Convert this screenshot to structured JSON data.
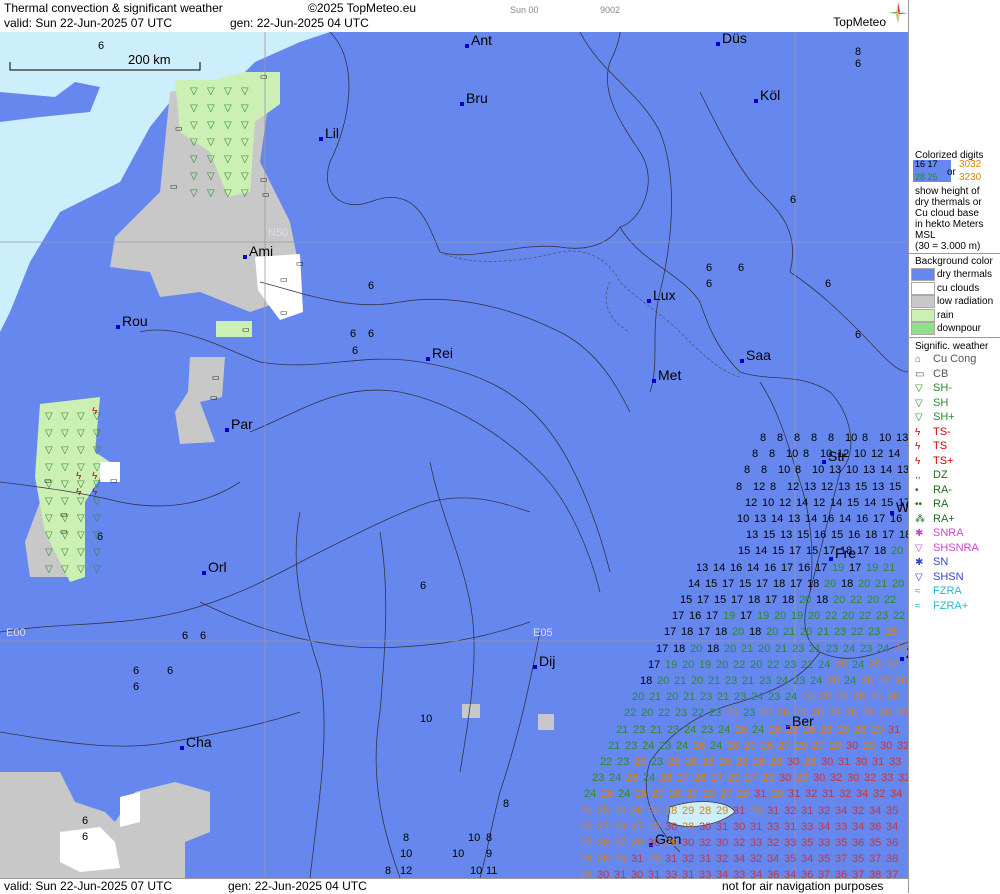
{
  "header": {
    "title": "Thermal convection & significant weather",
    "copyright": "©2025 TopMeteo.eu",
    "valid": "valid:  Sun  22-Jun-2025  07 UTC",
    "gen": "gen: 22-Jun-2025 04 UTC",
    "run_label": "Sun 00",
    "code_label": "9002",
    "brand": "TopMeteo"
  },
  "map": {
    "scale": "200 km",
    "grid_labels": {
      "n50": "N50",
      "e00": "E00",
      "e05": "E05"
    },
    "cities": [
      "Ant",
      "Düs",
      "Bru",
      "Köl",
      "Lil",
      "Ami",
      "Rou",
      "Rei",
      "Lux",
      "Saa",
      "Met",
      "Par",
      "Str",
      "Fre",
      "Orl",
      "Dij",
      "Ber",
      "Cha",
      "Gen",
      "Wü",
      "Z"
    ],
    "numbers": [
      "6",
      "8",
      "6",
      "6",
      "6",
      "6",
      "6",
      "6",
      "6",
      "6",
      "6",
      "6",
      "6",
      "6",
      "6",
      "6",
      "6",
      "6",
      "6",
      "6",
      "6",
      "6",
      "10",
      "8",
      "8",
      "8",
      "8",
      "10",
      "9",
      "10",
      "10",
      "10",
      "11",
      "12"
    ],
    "cluster_grid": [
      [
        8,
        "8"
      ],
      [
        9,
        "10"
      ],
      [
        10,
        "12"
      ],
      [
        11,
        "13"
      ],
      [
        12,
        "14"
      ],
      [
        13,
        "15"
      ],
      [
        14,
        "16"
      ],
      [
        15,
        "17"
      ],
      [
        16,
        "18"
      ],
      [
        17,
        "19"
      ],
      [
        18,
        "20"
      ],
      [
        19,
        "21"
      ],
      [
        20,
        "22"
      ],
      [
        21,
        "23"
      ],
      [
        22,
        "24"
      ],
      [
        23,
        "25"
      ],
      [
        24,
        "26"
      ],
      [
        25,
        "27"
      ],
      [
        26,
        "28"
      ],
      [
        27,
        "29"
      ],
      [
        28,
        "30"
      ],
      [
        29,
        "31"
      ],
      [
        32,
        "32"
      ],
      [
        33,
        "33"
      ],
      [
        34,
        "34"
      ],
      [
        35,
        "35"
      ],
      [
        36,
        "36"
      ],
      [
        37,
        "37"
      ],
      [
        38,
        "38"
      ]
    ]
  },
  "legend": {
    "colorized_title": "Colorized digits",
    "sample_a": "16  17",
    "sample_b": "28 25",
    "sample_c": "3032",
    "sample_d": "3230",
    "or": "or",
    "desc": [
      "show height of",
      "dry thermals or",
      "Cu cloud base",
      "in hekto Meters",
      "MSL",
      "(30 = 3.000 m)"
    ],
    "bg_title": "Background color",
    "bg_items": [
      {
        "label": "dry thermals",
        "color": "#6688ee"
      },
      {
        "label": "cu clouds",
        "color": "#ffffff"
      },
      {
        "label": "low radiation",
        "color": "#c8c8c8"
      },
      {
        "label": "rain",
        "color": "#ccf0b4"
      },
      {
        "label": "downpour",
        "color": "#8ee08a"
      }
    ],
    "sig_title": "Signific. weather",
    "sig_items": [
      {
        "label": "Cu Cong",
        "color": "#555555"
      },
      {
        "label": "CB",
        "color": "#555555"
      },
      {
        "label": "SH-",
        "color": "#2a8a2a"
      },
      {
        "label": "SH",
        "color": "#2a8a2a"
      },
      {
        "label": "SH+",
        "color": "#2a8a2a"
      },
      {
        "label": "TS-",
        "color": "#cc0000"
      },
      {
        "label": "TS",
        "color": "#cc0000"
      },
      {
        "label": "TS+",
        "color": "#cc0000"
      },
      {
        "label": "DZ",
        "color": "#1a6a1a"
      },
      {
        "label": "RA-",
        "color": "#1a6a1a"
      },
      {
        "label": "RA",
        "color": "#1a6a1a"
      },
      {
        "label": "RA+",
        "color": "#1a6a1a"
      },
      {
        "label": "SNRA",
        "color": "#cc44cc"
      },
      {
        "label": "SHSNRA",
        "color": "#cc44cc"
      },
      {
        "label": "SN",
        "color": "#3344cc"
      },
      {
        "label": "SHSN",
        "color": "#3344cc"
      },
      {
        "label": "FZRA",
        "color": "#22bbcc"
      },
      {
        "label": "FZRA+",
        "color": "#22bbcc"
      }
    ]
  },
  "footer": {
    "valid": "valid:  Sun  22-Jun-2025  07 UTC",
    "gen": "gen: 22-Jun-2025 04 UTC",
    "note": "not for air navigation purposes"
  }
}
